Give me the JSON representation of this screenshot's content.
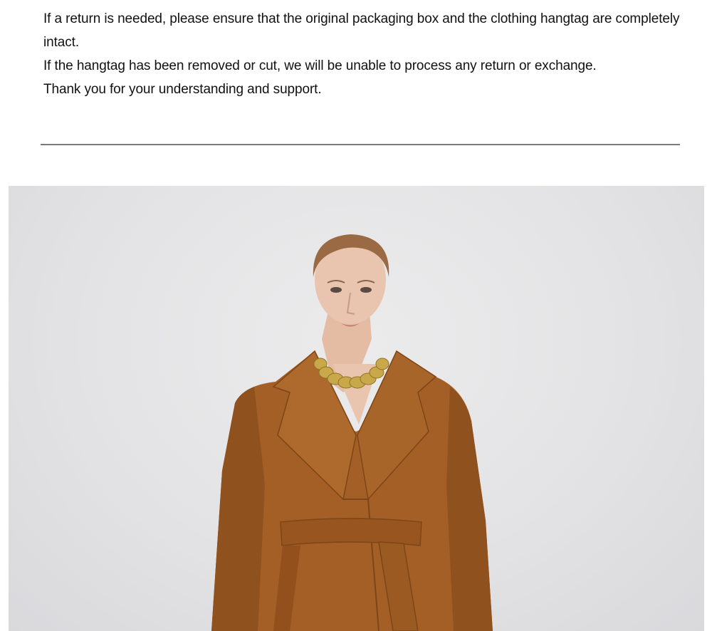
{
  "notice": {
    "line1": "If a return is needed, please ensure that the original packaging box and the clothing hangtag are completely intact.",
    "line2": "If the hangtag has been removed or cut, we will be unable to process any return or exchange.",
    "line3": "Thank you for your understanding and support."
  },
  "product_photo": {
    "subject": "model wearing camel wrap coat with belt and gold chunky necklace",
    "colors": {
      "background": "#e3e3e5",
      "coat": "#a35f25",
      "coat_dark": "#7e4518",
      "skin": "#e9c4ae",
      "hair": "#9a6a44",
      "necklace": "#c9a84a"
    }
  }
}
